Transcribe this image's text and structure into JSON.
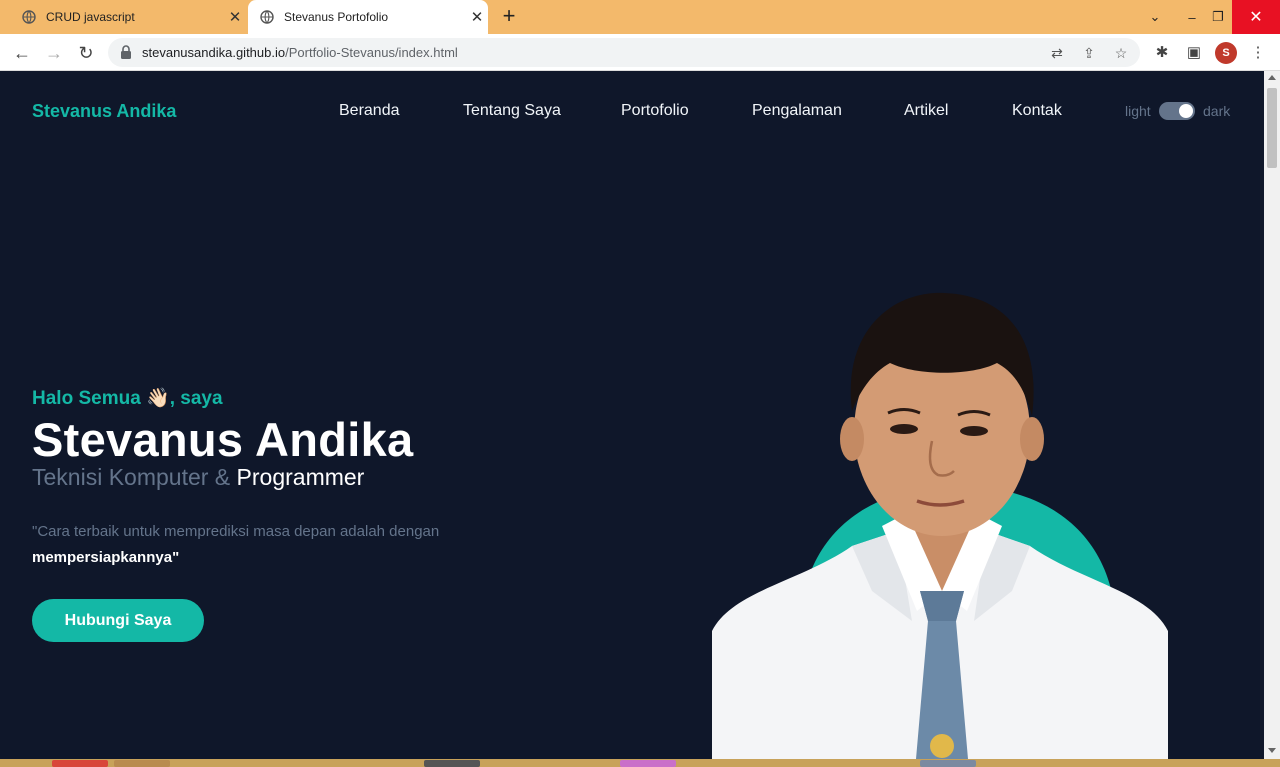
{
  "browser": {
    "tabs": [
      {
        "title": "CRUD javascript",
        "active": false
      },
      {
        "title": "Stevanus Portofolio",
        "active": true
      }
    ],
    "url_host": "stevanusandika.github.io",
    "url_path": "/Portfolio-Stevanus/index.html",
    "profile_initial": "S"
  },
  "nav": {
    "brand": "Stevanus Andika",
    "items": [
      "Beranda",
      "Tentang Saya",
      "Portofolio",
      "Pengalaman",
      "Artikel",
      "Kontak"
    ],
    "theme_light": "light",
    "theme_dark": "dark",
    "theme_state": "dark"
  },
  "hero": {
    "greeting_before": "Halo Semua",
    "greeting_emoji": "👋🏻",
    "greeting_after": ", saya",
    "name": "Stevanus Andika",
    "role_part1": "Teknisi Komputer & ",
    "role_part2": "Programmer",
    "quote_text": "\"Cara terbaik untuk memprediksi masa depan adalah dengan",
    "quote_bold": "mempersiapkannya\"",
    "cta_label": "Hubungi Saya"
  },
  "colors": {
    "accent": "#14b8a6",
    "background": "#0f172a",
    "muted_text": "#64748b",
    "tab_strip": "#f3b96b"
  }
}
